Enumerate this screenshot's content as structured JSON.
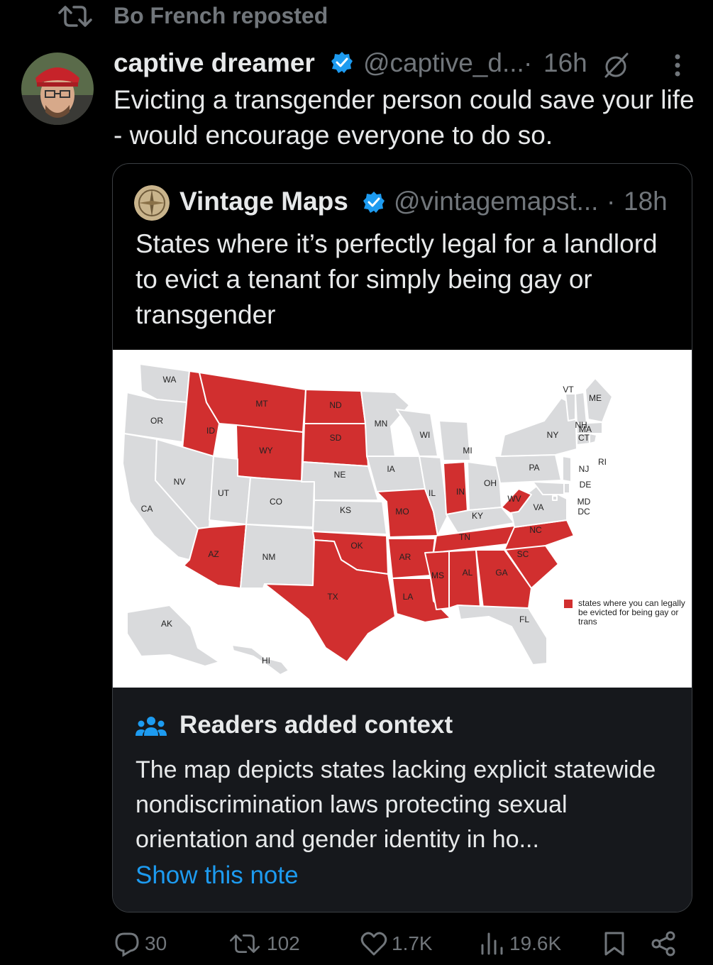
{
  "repost": {
    "text": "Bo French reposted"
  },
  "tweet": {
    "author_name": "captive dreamer",
    "author_handle": "@captive_d...",
    "separator": "·",
    "time": "16h",
    "text": "Evicting a transgender person could save your life - would encourage everyone to do so."
  },
  "quote": {
    "author_name": "Vintage Maps",
    "author_handle": "@vintagemapst...",
    "separator": "·",
    "time": "18h",
    "text": "States where it’s perfectly legal for a landlord to evict a tenant for simply being gay or transgender"
  },
  "map": {
    "legend_text_1": "states where you can legally",
    "legend_text_2": "be evicted for being gay or",
    "legend_text_3": "trans",
    "highlight_color": "#d12f2f",
    "base_color": "#d9dadc",
    "labels": {
      "WA": "WA",
      "OR": "OR",
      "CA": "CA",
      "ID": "ID",
      "NV": "NV",
      "MT": "MT",
      "WY": "WY",
      "UT": "UT",
      "AZ": "AZ",
      "CO": "CO",
      "NM": "NM",
      "ND": "ND",
      "SD": "SD",
      "NE": "NE",
      "KS": "KS",
      "OK": "OK",
      "TX": "TX",
      "MN": "MN",
      "IA": "IA",
      "MO": "MO",
      "AR": "AR",
      "LA": "LA",
      "WI": "WI",
      "IL": "IL",
      "MI": "MI",
      "IN": "IN",
      "OH": "OH",
      "KY": "KY",
      "TN": "TN",
      "MS": "MS",
      "AL": "AL",
      "GA": "GA",
      "FL": "FL",
      "SC": "SC",
      "NC": "NC",
      "VA": "VA",
      "WV": "WV",
      "PA": "PA",
      "NY": "NY",
      "ME": "ME",
      "VT": "VT",
      "NH": "NH",
      "MA": "MA",
      "CT": "CT",
      "RI": "RI",
      "NJ": "NJ",
      "DE": "DE",
      "MD": "MD",
      "DC": "DC",
      "AK": "AK",
      "HI": "HI"
    },
    "legal_states": [
      "ID",
      "MT",
      "WY",
      "AZ",
      "ND",
      "SD",
      "TX",
      "OK",
      "MO",
      "AR",
      "LA",
      "IN",
      "TN",
      "MS",
      "AL",
      "GA",
      "SC",
      "NC",
      "WV"
    ]
  },
  "context": {
    "title": "Readers added context",
    "text": "The map depicts states lacking explicit statewide nondiscrimination laws protecting sexual orientation and gender identity in ho...",
    "link": "Show this note"
  },
  "actions": {
    "replies": "30",
    "reposts": "102",
    "likes": "1.7K",
    "views": "19.6K"
  },
  "colors": {
    "accent": "#1d9bf0",
    "muted": "#71767b",
    "text": "#e7e9ea",
    "bg": "#000000"
  }
}
